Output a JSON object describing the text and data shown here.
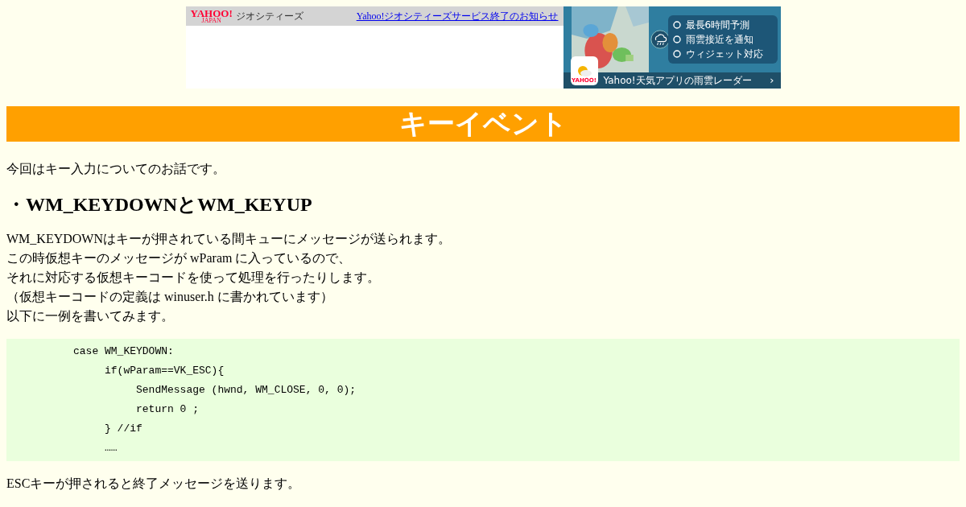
{
  "banner": {
    "logo": "YAHOO!",
    "logo_sub": "JAPAN",
    "service": "ジオシティーズ",
    "notice_link": "Yahoo!ジオシティーズサービス終了のお知らせ"
  },
  "ad": {
    "features": [
      "最長6時間予測",
      "雨雲接近を通知",
      "ウィジェット対応"
    ],
    "app_badge": "YAHOO!",
    "caption": "Yahoo!天気アプリの雨雲レーダー",
    "arrow": "›"
  },
  "title": "キーイベント",
  "intro": "今回はキー入力についてのお話です。",
  "heading": "・WM_KEYDOWNとWM_KEYUP",
  "paragraph_lines": [
    "WM_KEYDOWNはキーが押されている間キューにメッセージが送られます。",
    "この時仮想キーのメッセージが wParam に入っているので、",
    "それに対応する仮想キーコードを使って処理を行ったりします。",
    "（仮想キーコードの定義は winuser.h に書かれています）",
    "以下に一例を書いてみます。"
  ],
  "code": [
    {
      "text": "case WM_KEYDOWN:",
      "children": [
        {
          "text": "if(wParam==VK_ESC){",
          "children": [
            {
              "text": "SendMessage (hwnd, WM_CLOSE, 0, 0);"
            },
            {
              "text": "return 0 ;"
            }
          ]
        },
        {
          "text": "} //if"
        },
        {
          "text": "……"
        }
      ]
    }
  ],
  "outro": "ESCキーが押されると終了メッセージを送ります。"
}
